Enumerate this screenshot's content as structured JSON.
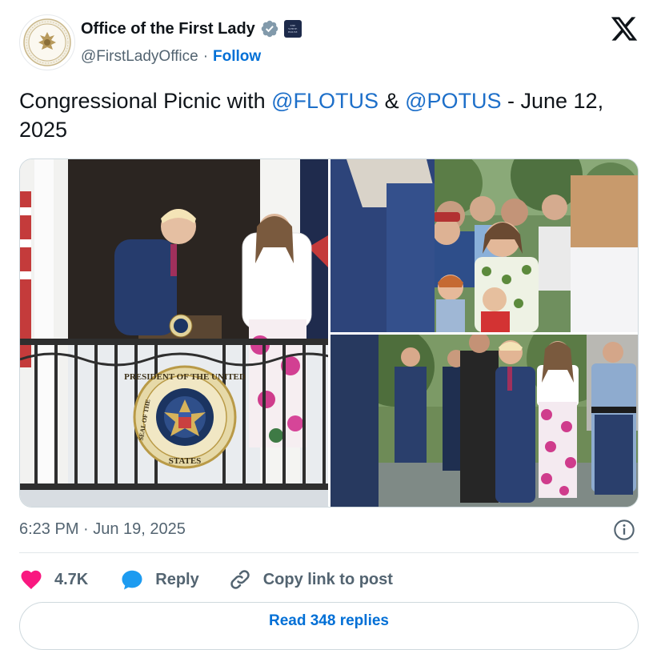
{
  "author": {
    "display_name": "Office of the First Lady",
    "handle": "@FirstLadyOffice",
    "separator": "·",
    "follow_label": "Follow",
    "affiliation_badge_lines": [
      "THE",
      "WHITE",
      "HOUSE"
    ],
    "avatar_icon": "seal-icon",
    "verified_icon": "verified-badge-icon"
  },
  "platform_icon": "x-logo-icon",
  "tweet": {
    "text_before": "Congressional Picnic with ",
    "mention1": "@FLOTUS",
    "text_middle": " & ",
    "mention2": "@POTUS",
    "text_after": " - June 12, 2025"
  },
  "media": {
    "seal_text_top": "PRESIDENT OF THE UNITED",
    "seal_text_bottom": "STATES",
    "seal_text_left": "SEAL OF THE"
  },
  "meta": {
    "timestamp": "6:23 PM · Jun 19, 2025",
    "info_icon": "info-icon"
  },
  "actions": {
    "like_count": "4.7K",
    "reply_label": "Reply",
    "copy_label": "Copy link to post"
  },
  "read_replies_label": "Read 348 replies",
  "colors": {
    "link_blue": "#006fd6",
    "mention_blue": "#1d6fc9",
    "like_pink": "#f91880",
    "reply_blue": "#1d9bf0",
    "verified_gray": "#829aab"
  }
}
